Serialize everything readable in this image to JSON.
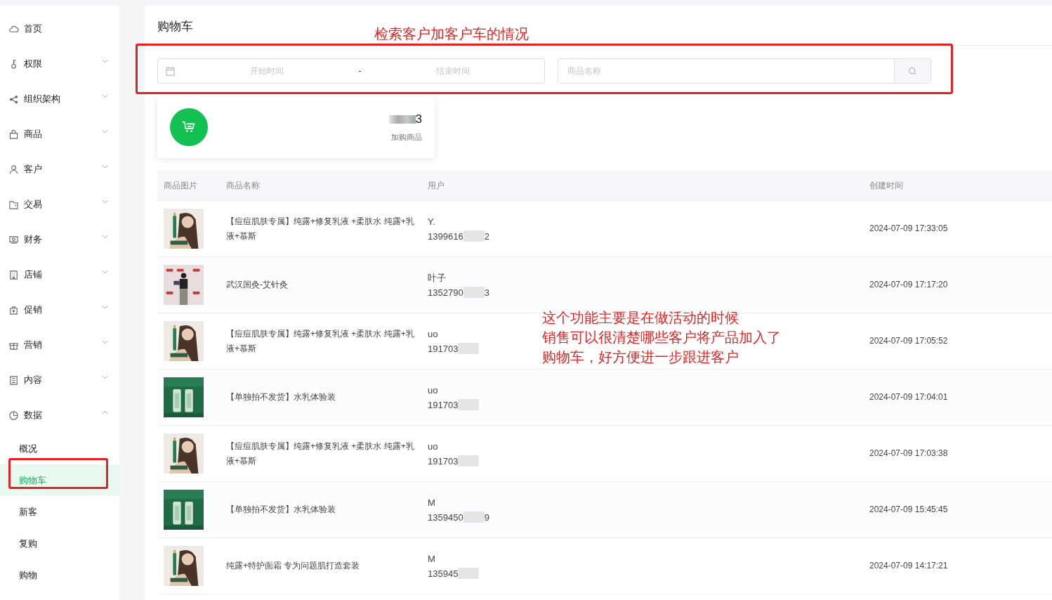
{
  "sidebar": {
    "items": [
      {
        "label": "首页",
        "expandable": false,
        "expanded": false
      },
      {
        "label": "权限",
        "expandable": true,
        "expanded": false
      },
      {
        "label": "组织架构",
        "expandable": true,
        "expanded": false
      },
      {
        "label": "商品",
        "expandable": true,
        "expanded": false
      },
      {
        "label": "客户",
        "expandable": true,
        "expanded": false
      },
      {
        "label": "交易",
        "expandable": true,
        "expanded": false
      },
      {
        "label": "财务",
        "expandable": true,
        "expanded": false
      },
      {
        "label": "店铺",
        "expandable": true,
        "expanded": false
      },
      {
        "label": "促销",
        "expandable": true,
        "expanded": false
      },
      {
        "label": "营销",
        "expandable": true,
        "expanded": false
      },
      {
        "label": "内容",
        "expandable": true,
        "expanded": false
      },
      {
        "label": "数据",
        "expandable": true,
        "expanded": true,
        "children": [
          {
            "label": "概况",
            "selected": false
          },
          {
            "label": "购物车",
            "selected": true
          },
          {
            "label": "新客",
            "selected": false
          },
          {
            "label": "复购",
            "selected": false
          },
          {
            "label": "购物",
            "selected": false
          }
        ]
      }
    ]
  },
  "page": {
    "title": "购物车"
  },
  "filters": {
    "start_placeholder": "开始时间",
    "separator": "-",
    "end_placeholder": "结束时间",
    "search_placeholder": "商品名称"
  },
  "stat_card": {
    "count": "3",
    "label": "加购商品"
  },
  "table": {
    "columns": [
      "商品图片",
      "商品名称",
      "用户",
      "创建时间"
    ],
    "rows": [
      {
        "name": "【痘痘肌肤专属】纯露+修复乳液 +柔肤水 纯露+乳液+慕斯",
        "user": "Y.",
        "phone": "1399616",
        "phone_end": "2",
        "time": "2024-07-09 17:33:05"
      },
      {
        "name": "武汉国灸-艾针灸",
        "user": "叶子",
        "phone": "1352790",
        "phone_end": "3",
        "time": "2024-07-09 17:17:20"
      },
      {
        "name": "【痘痘肌肤专属】纯露+修复乳液 +柔肤水 纯露+乳液+慕斯",
        "user": "uo",
        "phone": "191703",
        "time": "2024-07-09 17:05:52"
      },
      {
        "name": "【单独拍不发货】水乳体验装",
        "user": "uo",
        "phone": "191703",
        "time": "2024-07-09 17:04:01"
      },
      {
        "name": "【痘痘肌肤专属】纯露+修复乳液 +柔肤水 纯露+乳液+慕斯",
        "user": "uo",
        "phone": "191703",
        "time": "2024-07-09 17:03:38"
      },
      {
        "name": "【单独拍不发货】水乳体验装",
        "user": "M",
        "phone": "1359450",
        "phone_end": "9",
        "time": "2024-07-09 15:45:45"
      },
      {
        "name": "纯露+特护面霜 专为问题肌打造套装",
        "user": "M",
        "phone": "135945",
        "time": "2024-07-09 14:17:21"
      }
    ]
  },
  "annotations": [
    {
      "kind": "filter_box",
      "text": "检索客户加客户车的情况"
    },
    {
      "kind": "menu_box"
    },
    {
      "kind": "note",
      "lines": [
        "这个功能主要是在做活动的时候",
        "销售可以很清楚哪些客户将产品加入了",
        "购物车，好方便进一步跟进客户"
      ]
    }
  ]
}
